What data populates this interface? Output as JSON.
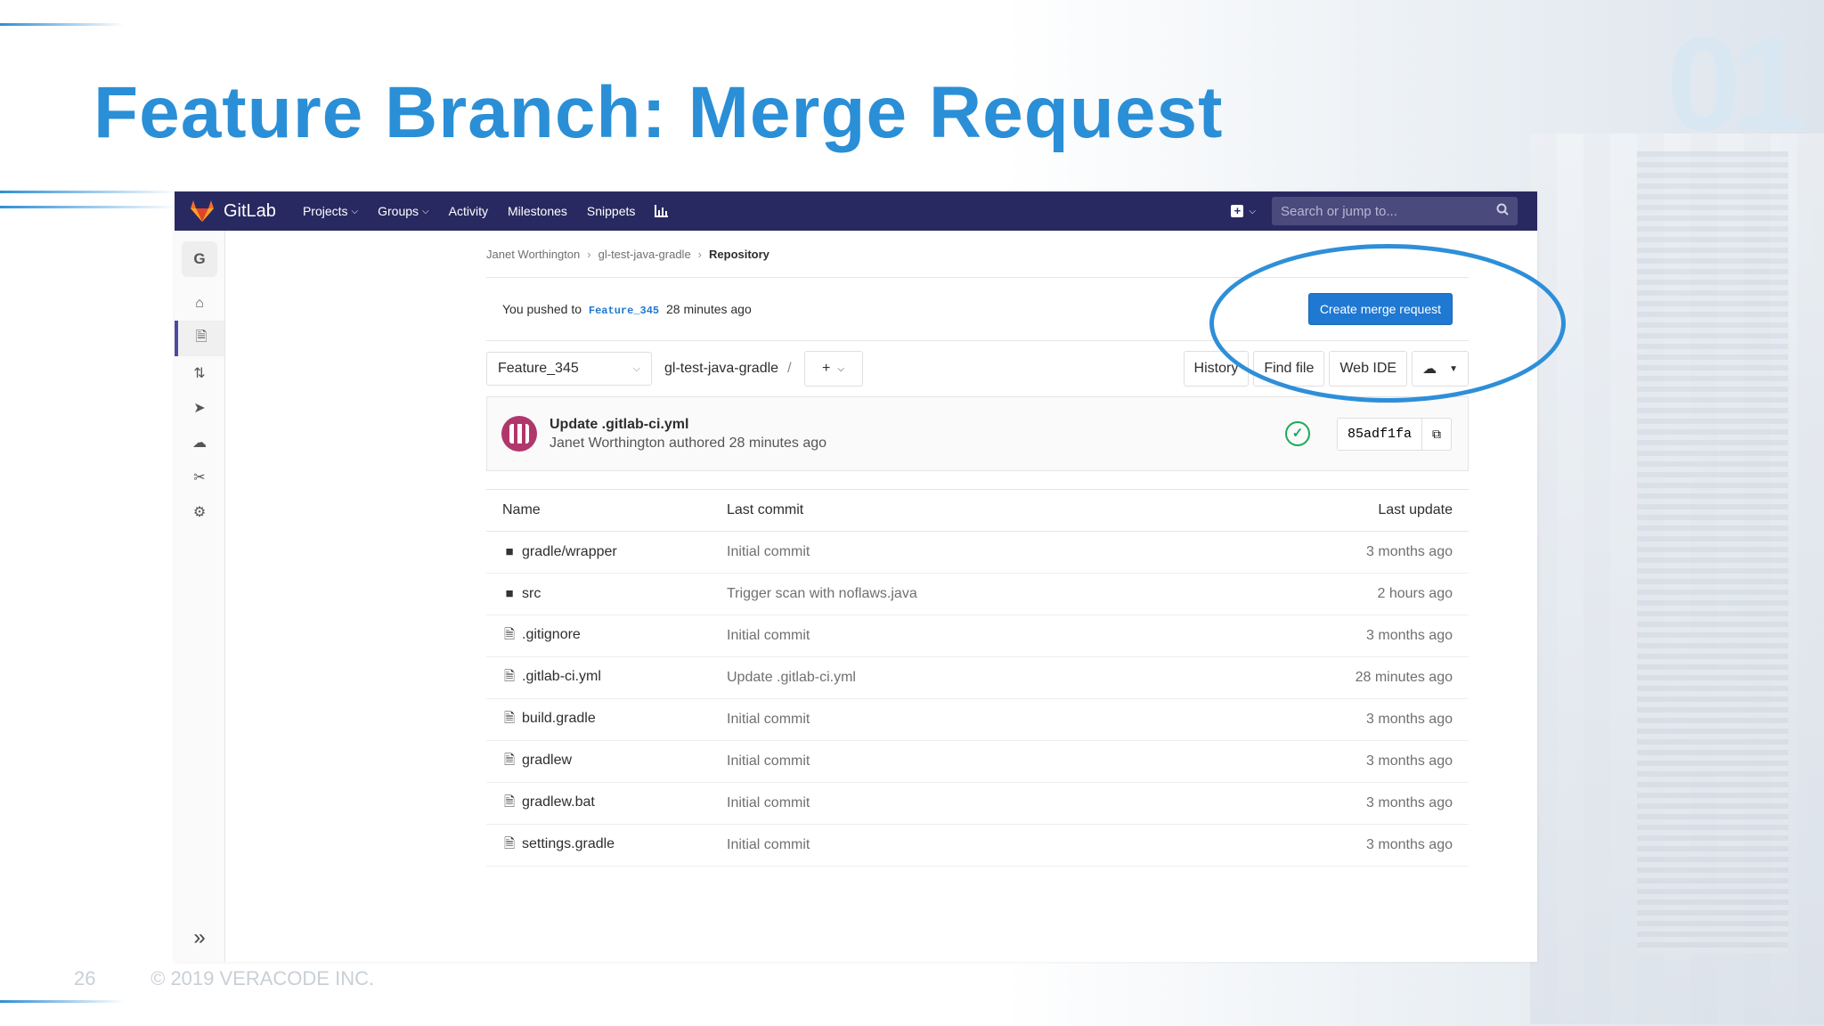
{
  "slide": {
    "title": "Feature Branch: Merge Request",
    "corner_number": "01",
    "page_number": "26",
    "copyright": "© 2019 VERACODE INC."
  },
  "navbar": {
    "brand": "GitLab",
    "items": [
      {
        "label": "Projects",
        "dropdown": true
      },
      {
        "label": "Groups",
        "dropdown": true
      },
      {
        "label": "Activity",
        "dropdown": false
      },
      {
        "label": "Milestones",
        "dropdown": false
      },
      {
        "label": "Snippets",
        "dropdown": false
      }
    ],
    "search_placeholder": "Search or jump to..."
  },
  "sidebar": {
    "project_initial": "G",
    "icons": [
      "home-icon",
      "repository-icon",
      "merge-request-icon",
      "rocket-icon",
      "operations-icon",
      "snippets-icon",
      "settings-icon"
    ]
  },
  "breadcrumb": [
    "Janet Worthington",
    "gl-test-java-gradle",
    "Repository"
  ],
  "push_notice": {
    "prefix": "You pushed to",
    "branch": "Feature_345",
    "suffix": "28 minutes ago",
    "button": "Create merge request"
  },
  "toolbar": {
    "branch": "Feature_345",
    "path": "gl-test-java-gradle",
    "slash": "/",
    "add": "+",
    "history": "History",
    "find_file": "Find file",
    "web_ide": "Web IDE"
  },
  "last_commit": {
    "title": "Update .gitlab-ci.yml",
    "author_line": "Janet Worthington authored 28 minutes ago",
    "sha": "85adf1fa"
  },
  "files": {
    "headers": {
      "name": "Name",
      "commit": "Last commit",
      "update": "Last update"
    },
    "rows": [
      {
        "type": "folder",
        "name": "gradle/wrapper",
        "commit": "Initial commit",
        "update": "3 months ago"
      },
      {
        "type": "folder",
        "name": "src",
        "commit": "Trigger scan with noflaws.java",
        "update": "2 hours ago"
      },
      {
        "type": "file",
        "name": ".gitignore",
        "commit": "Initial commit",
        "update": "3 months ago"
      },
      {
        "type": "file",
        "name": ".gitlab-ci.yml",
        "commit": "Update .gitlab-ci.yml",
        "update": "28 minutes ago"
      },
      {
        "type": "file",
        "name": "build.gradle",
        "commit": "Initial commit",
        "update": "3 months ago"
      },
      {
        "type": "file",
        "name": "gradlew",
        "commit": "Initial commit",
        "update": "3 months ago"
      },
      {
        "type": "file",
        "name": "gradlew.bat",
        "commit": "Initial commit",
        "update": "3 months ago"
      },
      {
        "type": "file",
        "name": "settings.gradle",
        "commit": "Initial commit",
        "update": "3 months ago"
      }
    ]
  },
  "colors": {
    "title": "#2a8fd6",
    "navbar": "#292961",
    "primary_button": "#1f78d1",
    "success": "#1aaa55",
    "highlight_ring": "#2e8fd8"
  }
}
